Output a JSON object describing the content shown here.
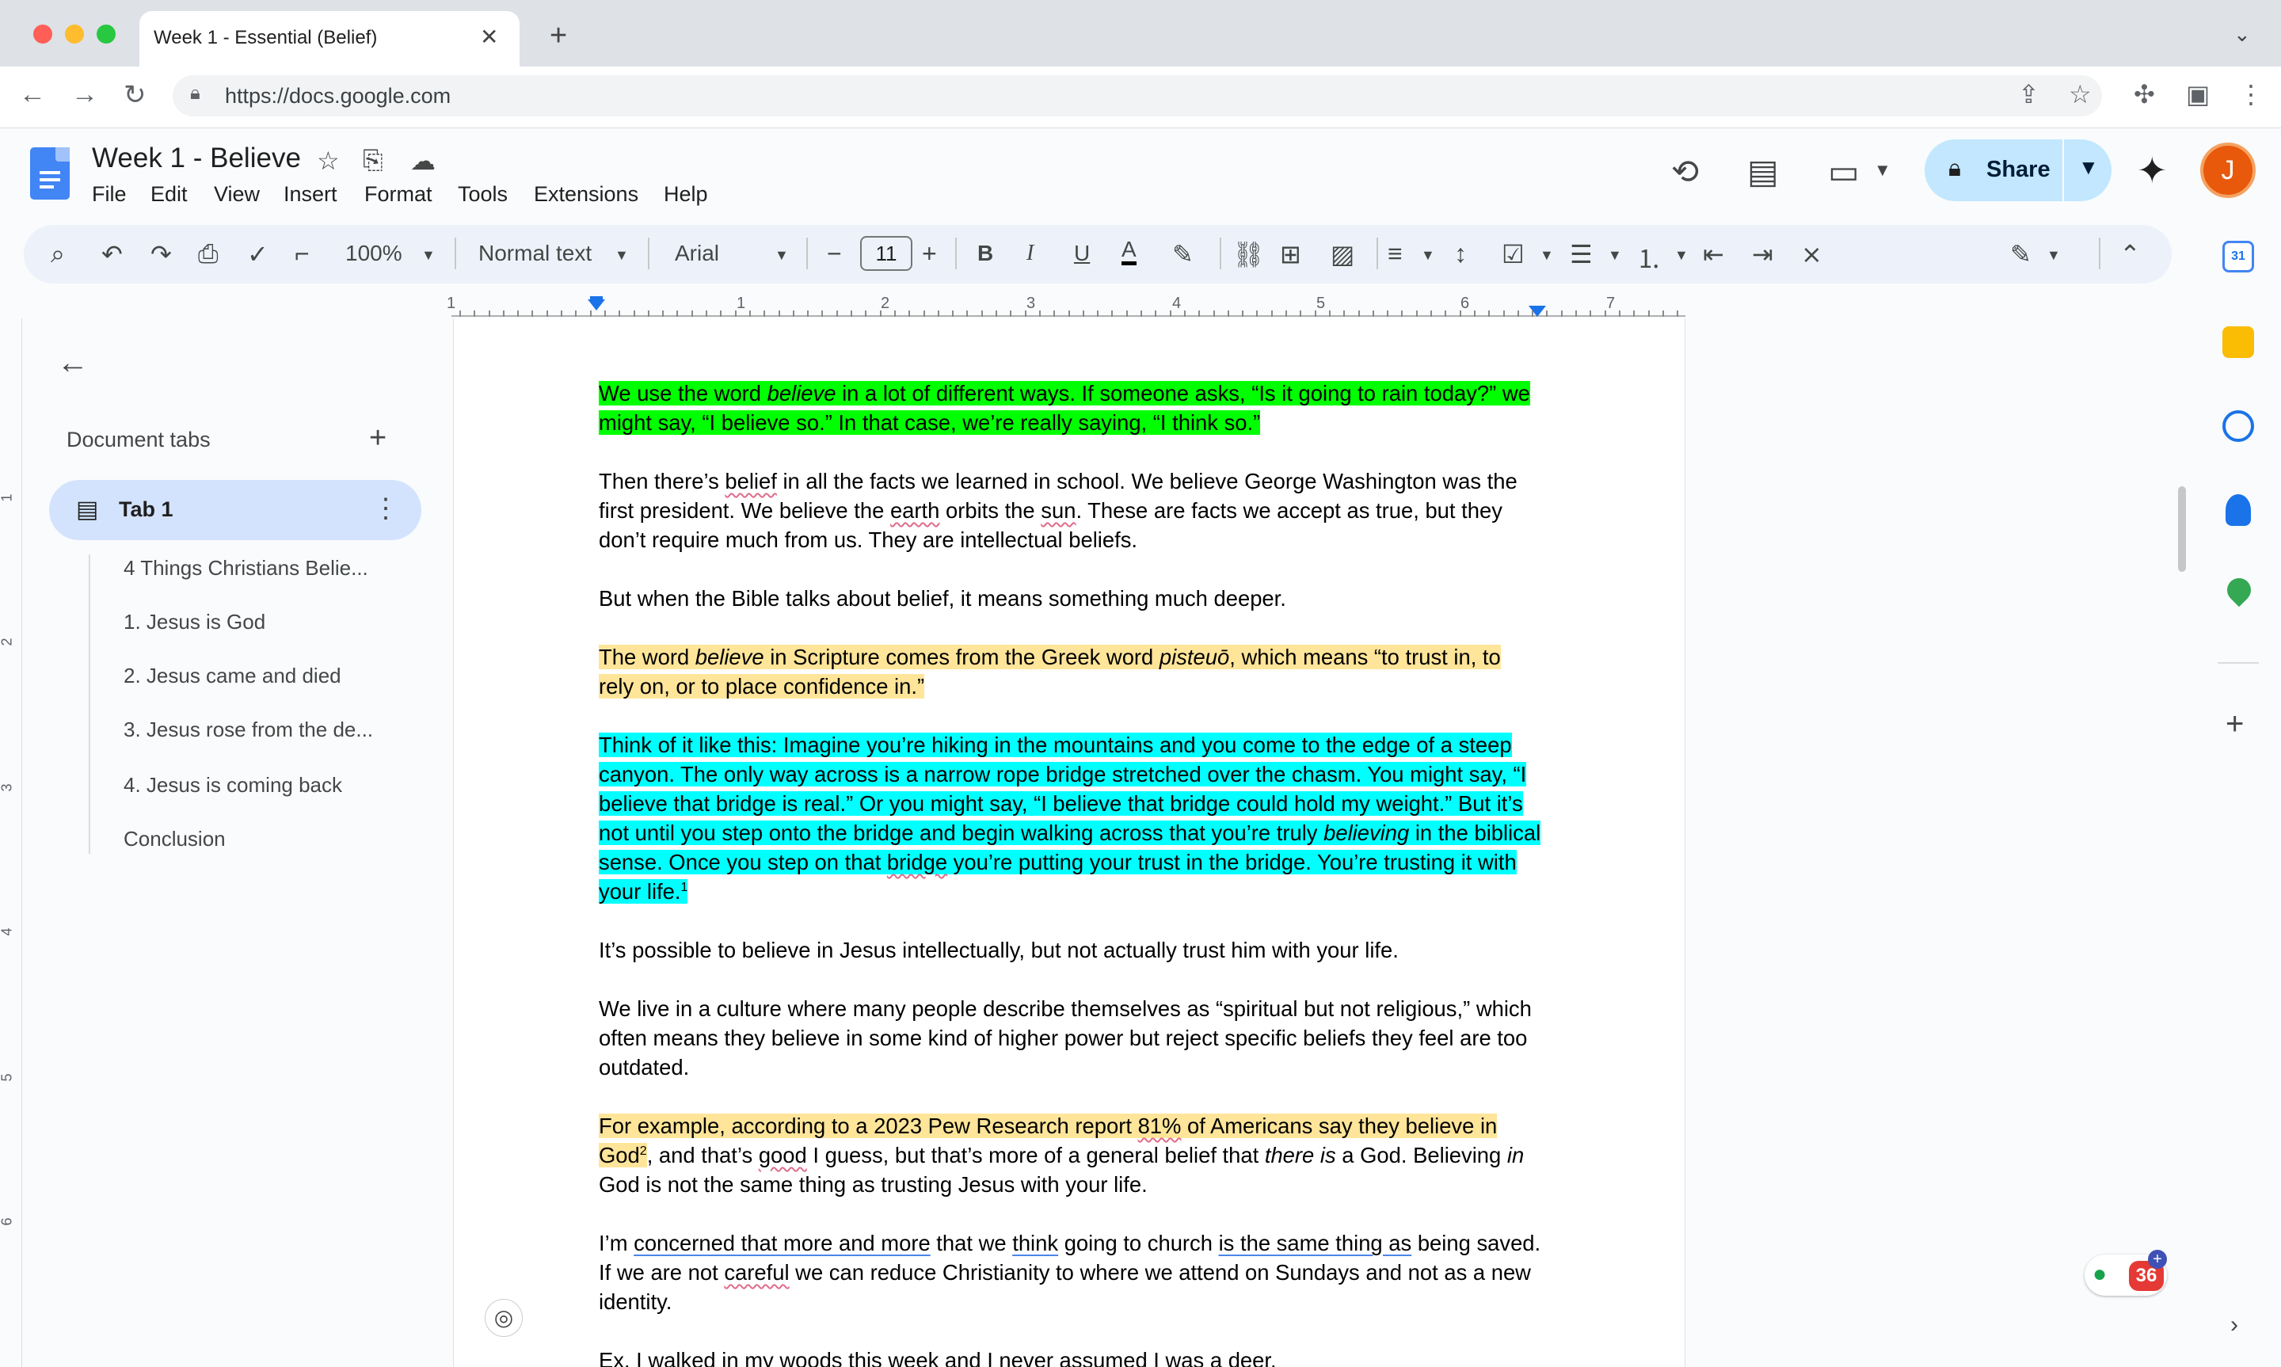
{
  "browser": {
    "tab_title": "Week 1 - Essential (Belief)",
    "url": "https://docs.google.com"
  },
  "doc": {
    "title": "Week 1 - Believe",
    "menu": [
      "File",
      "Edit",
      "View",
      "Insert",
      "Format",
      "Tools",
      "Extensions",
      "Help"
    ],
    "share_label": "Share",
    "avatar_letter": "J"
  },
  "toolbar": {
    "zoom": "100%",
    "style": "Normal text",
    "font": "Arial",
    "font_size": "11"
  },
  "ruler": {
    "labels": [
      "1",
      "1",
      "2",
      "3",
      "4",
      "5",
      "6",
      "7"
    ],
    "vlabels": [
      "1",
      "2",
      "3",
      "4",
      "5",
      "6"
    ]
  },
  "sidebar": {
    "heading": "Document tabs",
    "tab_label": "Tab 1",
    "outline": [
      "4 Things Christians Belie...",
      "1. Jesus is God",
      "2. Jesus came and died",
      "3. Jesus rose from the de...",
      "4. Jesus is coming back",
      "Conclusion"
    ]
  },
  "body": {
    "p1": {
      "a": "We use the word ",
      "b": "believe",
      "c": " in a lot of different ways. If someone asks, “Is it going to rain today?” we might say, “I believe so.” In that case, we’re really saying, “I think so.”"
    },
    "p2": {
      "a": "Then there’s ",
      "belief": "belief",
      "b": " in all the facts we learned in school. We believe George Washington was the first president. We believe the ",
      "earth": "earth",
      "c": " orbits the ",
      "sun": "sun",
      "d": ". These are facts we accept as true, but they don’t require much from us. They are intellectual beliefs."
    },
    "p3": "But when the Bible talks about belief, it means something much deeper.",
    "p4": {
      "a": "The word ",
      "b": "believe",
      "c": " in Scripture comes from the Greek word ",
      "d": "pisteuō",
      "e": ", which means “to trust in, to rely on, or to place confidence in.”"
    },
    "p5": {
      "a": "Think of it like this: Imagine you’re hiking in the mountains and you come to the edge of a steep canyon. The only way across is a narrow rope bridge stretched over the chasm. You might say, “I believe that bridge is real.” Or you might say, “I believe that bridge could hold my weight.” But it’s not until you step onto the bridge and begin walking across that you’re truly ",
      "b": "believing",
      "c": " in the biblical sense. Once you step on that ",
      "bridge": "bridge",
      "d": " you’re putting your trust in the bridge. You’re trusting it with your life.",
      "sup": "1"
    },
    "p6": "It’s possible to believe in Jesus intellectually, but not actually trust him with your life.",
    "p7": "We live in a culture where many people describe themselves as “spiritual but not religious,” which often means they believe in some kind of higher power but reject specific beliefs they feel are too outdated.",
    "p8": {
      "a": "For example, according to a 2023 Pew Research report ",
      "pct": "81%",
      "b": " of Americans say they believe in God",
      "sup": "2",
      "c": ", and that’s ",
      "good": "good",
      "d": " I guess, but that’s more of a general belief that ",
      "e": "there is",
      "f": " a God. Believing ",
      "g": "in",
      "h": " God is not the same thing as trusting Jesus with your life."
    },
    "p9": {
      "a": "I’m ",
      "b": "concerned that more and more",
      "c": " that we ",
      "think": "think",
      "d": " going to church ",
      "e": "is the same thing as",
      "f": " being saved. If we are not ",
      "careful": "careful",
      "g": " we can reduce Christianity to where we attend on Sundays and not as a new identity."
    },
    "p10": "Ex. I walked in my woods this week and I never assumed I was a deer."
  },
  "extension_badge": "36",
  "colors": {
    "highlight_green": "#00ff00",
    "highlight_yellow": "#ffe599",
    "highlight_cyan": "#00ffff",
    "share_bg": "#c2e7ff",
    "tab_selected_bg": "#d3e3fd"
  }
}
